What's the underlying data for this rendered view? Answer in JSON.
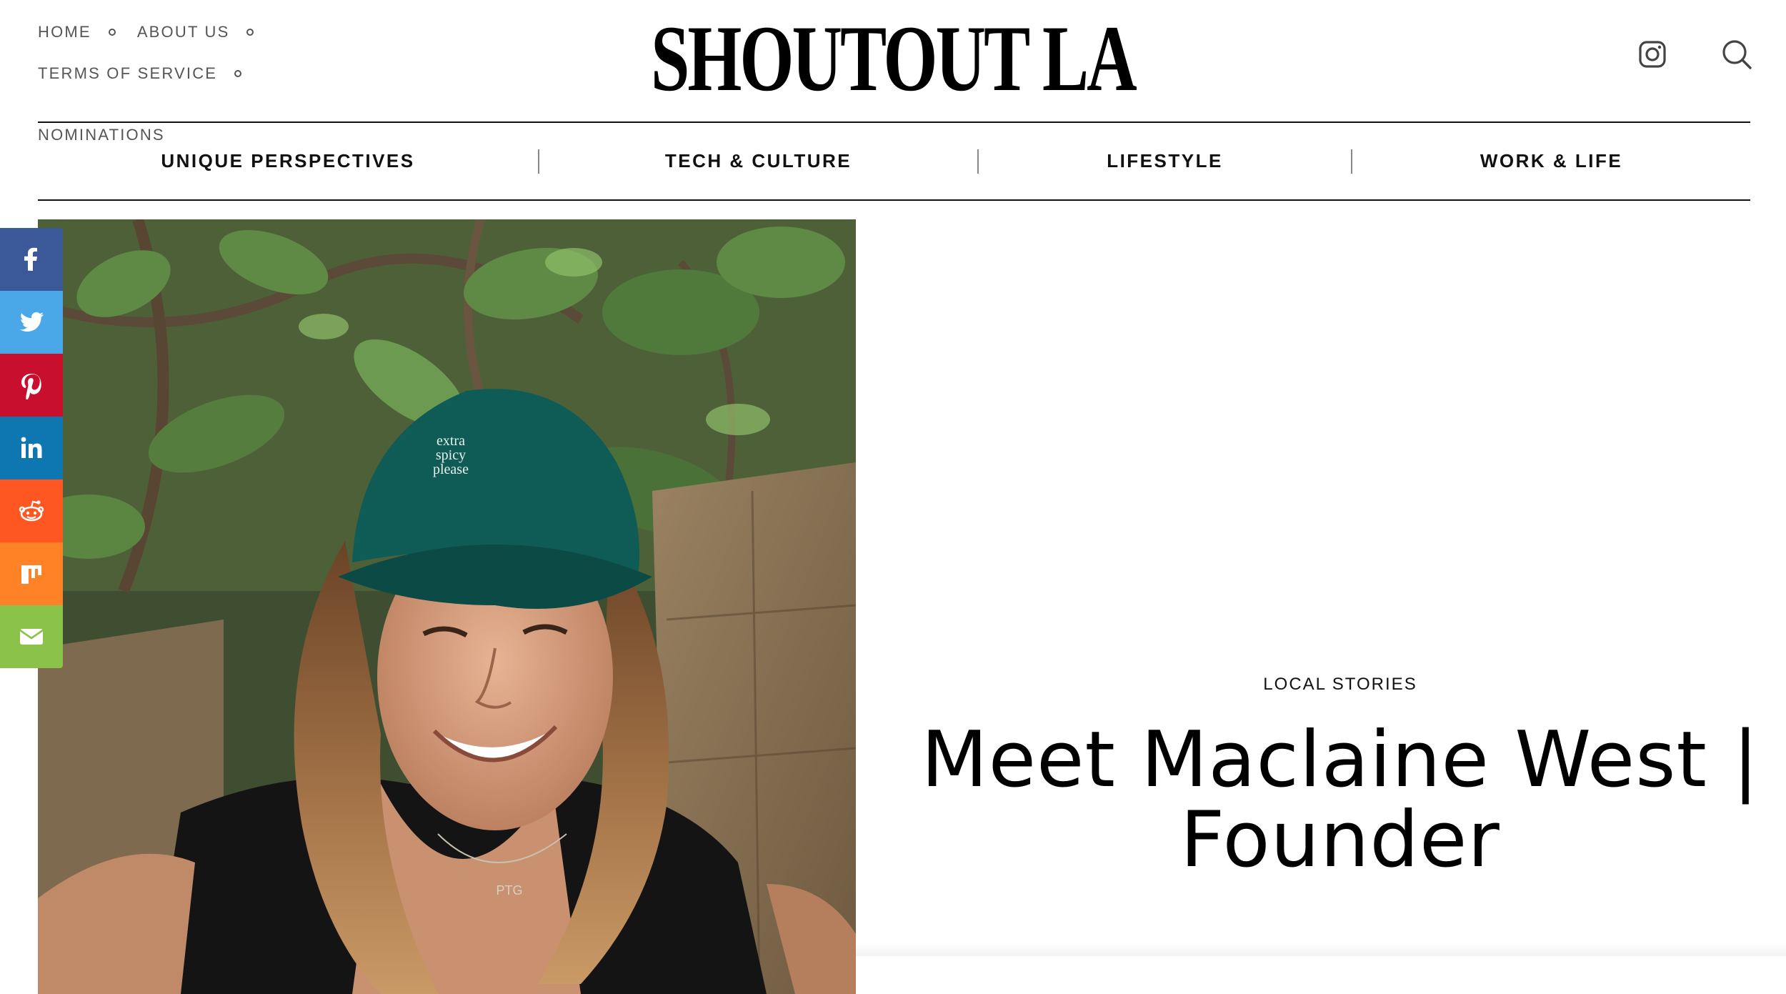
{
  "header": {
    "nav": [
      {
        "label": "HOME"
      },
      {
        "label": "ABOUT US"
      },
      {
        "label": "TERMS OF SERVICE"
      },
      {
        "label": "NOMINATIONS"
      }
    ],
    "logo": "SHOUTOUT LA",
    "icons": [
      "instagram-icon",
      "search-icon"
    ]
  },
  "categories": [
    {
      "label": "UNIQUE PERSPECTIVES"
    },
    {
      "label": "TECH & CULTURE"
    },
    {
      "label": "LIFESTYLE"
    },
    {
      "label": "WORK & LIFE"
    }
  ],
  "share": [
    {
      "name": "facebook",
      "color": "#3b5998"
    },
    {
      "name": "twitter",
      "color": "#4aa8e8"
    },
    {
      "name": "pinterest",
      "color": "#c8102e"
    },
    {
      "name": "linkedin",
      "color": "#0e76b0"
    },
    {
      "name": "reddit",
      "color": "#ff5722"
    },
    {
      "name": "mix",
      "color": "#ff8226"
    },
    {
      "name": "email",
      "color": "#8bc34a"
    }
  ],
  "hero": {
    "cap_text": [
      "extra",
      "spicy",
      "please"
    ],
    "necklace_text": "PTG"
  },
  "article": {
    "category": "LOCAL STORIES",
    "title_line1": "Meet Maclaine West |",
    "title_line2": "Founder"
  }
}
